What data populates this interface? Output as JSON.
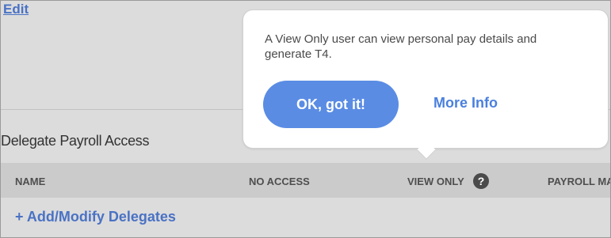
{
  "edit_link": "Edit",
  "section_title": "Delegate Payroll Access",
  "table": {
    "headers": [
      "NAME",
      "NO ACCESS",
      "VIEW ONLY",
      "PAYROLL MA"
    ]
  },
  "help_icon_glyph": "?",
  "add_link": "+ Add/Modify Delegates",
  "tooltip": {
    "message": "A View Only user can view personal pay details and generate T4.",
    "ok_label": "OK, got it!",
    "more_info_label": "More Info"
  },
  "colors": {
    "link": "#4a72c4",
    "button": "#5a8ce4"
  }
}
